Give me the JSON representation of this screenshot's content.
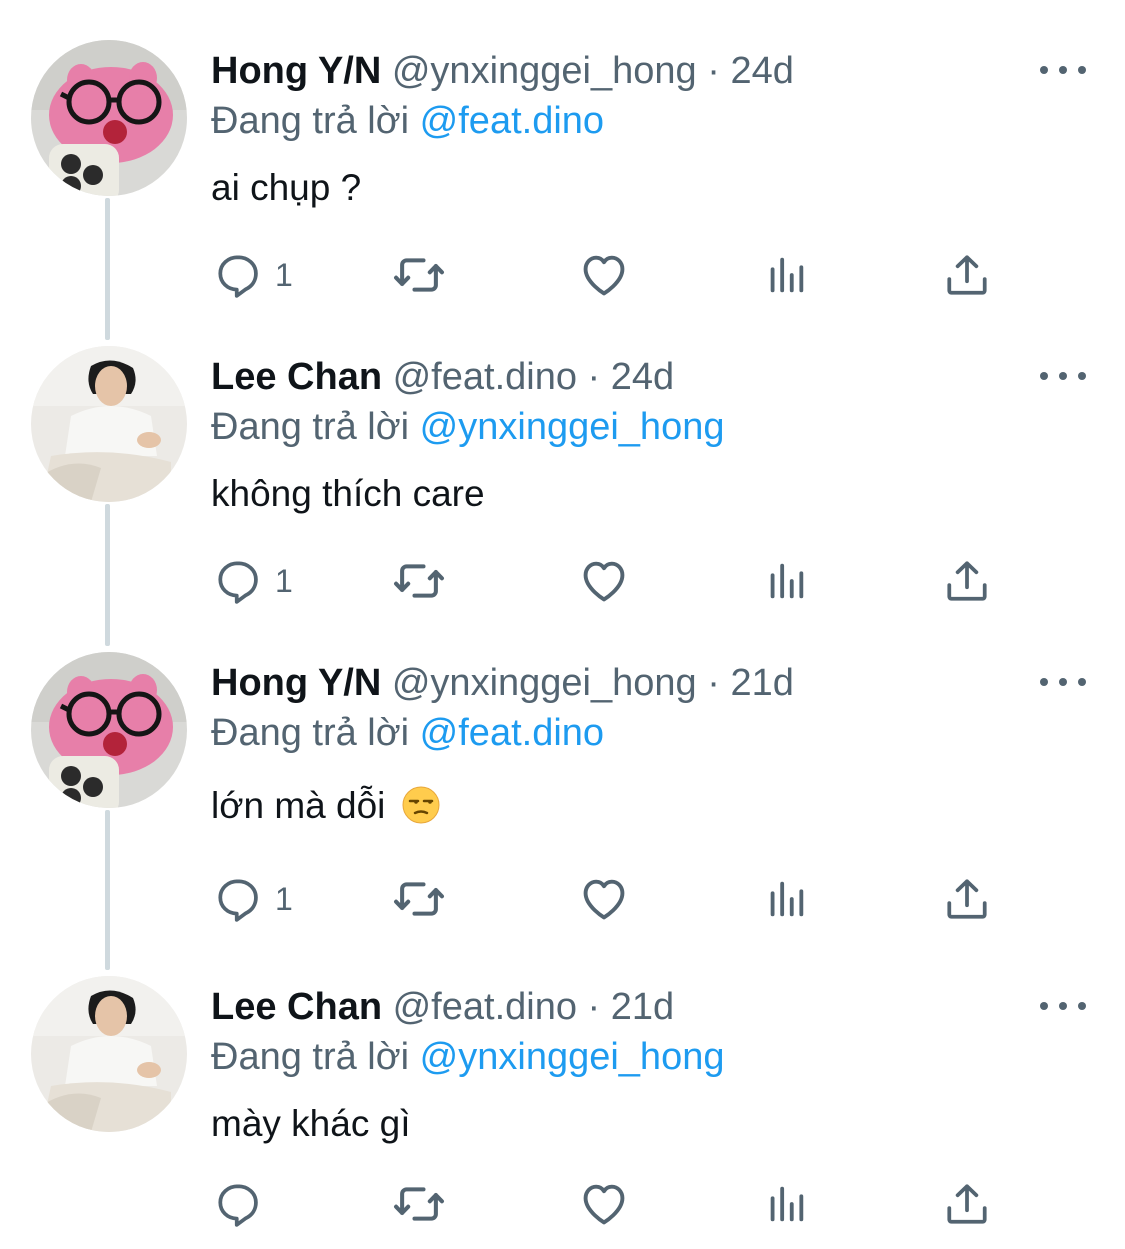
{
  "tweets": [
    {
      "name": "Hong Y/N",
      "handle": "@ynxinggei_hong",
      "time": "· 24d",
      "reply_prefix": "Đang trả lời",
      "reply_to": "@feat.dino",
      "text": "ai chụp ?",
      "reply_count": "1",
      "avatar": "pink-plush-avatar"
    },
    {
      "name": "Lee Chan",
      "handle": "@feat.dino",
      "time": "· 24d",
      "reply_prefix": "Đang trả lời",
      "reply_to": "@ynxinggei_hong",
      "text": "không thích care",
      "reply_count": "1",
      "avatar": "person-photo-avatar"
    },
    {
      "name": "Hong Y/N",
      "handle": "@ynxinggei_hong",
      "time": "· 21d",
      "reply_prefix": "Đang trả lời",
      "reply_to": "@feat.dino",
      "text": "lớn mà dỗi",
      "reply_count": "1",
      "avatar": "pink-plush-avatar",
      "emoji": "unamused-face-emoji"
    },
    {
      "name": "Lee Chan",
      "handle": "@feat.dino",
      "time": "· 21d",
      "reply_prefix": "Đang trả lời",
      "reply_to": "@ynxinggei_hong",
      "text": "mày khác gì",
      "reply_count": "",
      "avatar": "person-photo-avatar"
    }
  ],
  "icons": [
    "reply-icon",
    "retweet-icon",
    "like-icon",
    "views-icon",
    "share-icon",
    "more-icon"
  ],
  "colors": {
    "text": "#0f1419",
    "secondary": "#536471",
    "mention": "#1d9bf0",
    "thread_line": "#cfd9de"
  }
}
